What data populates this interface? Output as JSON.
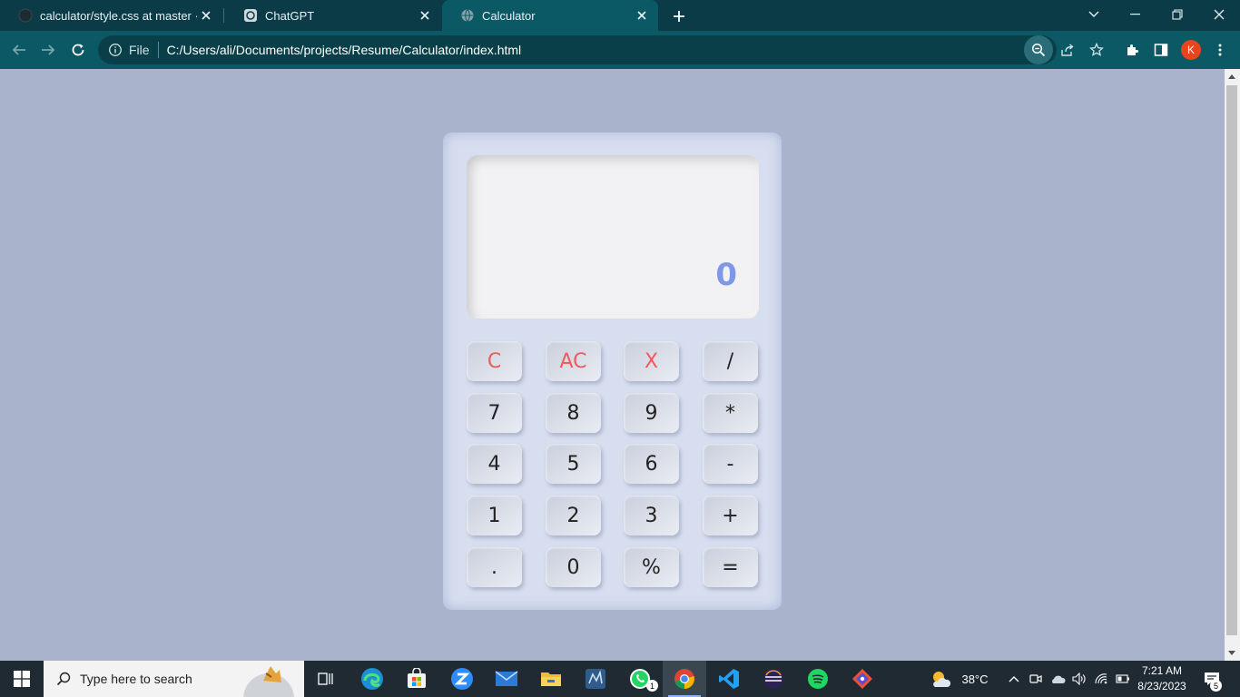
{
  "browser": {
    "tabs": [
      {
        "title": "calculator/style.css at master · ya",
        "icon": "github-icon"
      },
      {
        "title": "ChatGPT",
        "icon": "chatgpt-icon"
      },
      {
        "title": "Calculator",
        "icon": "globe-icon"
      }
    ],
    "omnibox": {
      "scheme_label": "File",
      "url": "C:/Users/ali/Documents/projects/Resume/Calculator/index.html"
    },
    "profile_initial": "K"
  },
  "calculator": {
    "display_value": "0",
    "keys": [
      {
        "label": "C",
        "name": "key-clear"
      },
      {
        "label": "AC",
        "name": "key-all-clear"
      },
      {
        "label": "X",
        "name": "key-delete"
      },
      {
        "label": "/",
        "name": "key-divide"
      },
      {
        "label": "7",
        "name": "key-7"
      },
      {
        "label": "8",
        "name": "key-8"
      },
      {
        "label": "9",
        "name": "key-9"
      },
      {
        "label": "*",
        "name": "key-multiply"
      },
      {
        "label": "4",
        "name": "key-4"
      },
      {
        "label": "5",
        "name": "key-5"
      },
      {
        "label": "6",
        "name": "key-6"
      },
      {
        "label": "-",
        "name": "key-subtract"
      },
      {
        "label": "1",
        "name": "key-1"
      },
      {
        "label": "2",
        "name": "key-2"
      },
      {
        "label": "3",
        "name": "key-3"
      },
      {
        "label": "+",
        "name": "key-add"
      },
      {
        "label": ".",
        "name": "key-decimal"
      },
      {
        "label": "0",
        "name": "key-0"
      },
      {
        "label": "%",
        "name": "key-percent"
      },
      {
        "label": "=",
        "name": "key-equals"
      }
    ],
    "colors": {
      "accent_red": "#f05a5a",
      "display_text": "#7f98e6",
      "page_bg": "#a9b4cc"
    }
  },
  "taskbar": {
    "search_placeholder": "Type here to search",
    "whatsapp_badge": "1",
    "weather": "38°C",
    "time": "7:21 AM",
    "date": "8/23/2023",
    "notification_count": "5"
  }
}
